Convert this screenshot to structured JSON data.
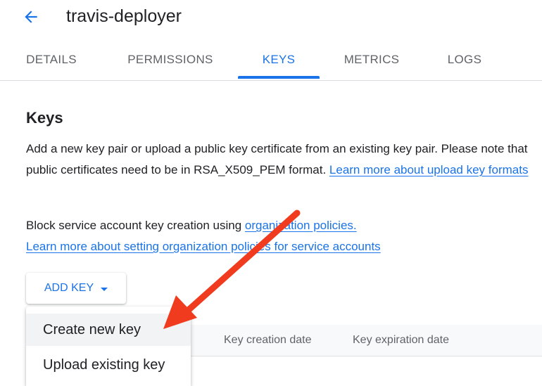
{
  "header": {
    "title": "travis-deployer"
  },
  "tabs": [
    {
      "label": "DETAILS"
    },
    {
      "label": "PERMISSIONS"
    },
    {
      "label": "KEYS"
    },
    {
      "label": "METRICS"
    },
    {
      "label": "LOGS"
    }
  ],
  "active_tab": "KEYS",
  "section": {
    "title": "Keys",
    "description": "Add a new key pair or upload a public key certificate from an existing key pair. Please note that public certificates need to be in RSA_X509_PEM format. ",
    "learn_formats_link": "Learn more about upload key formats",
    "block_text": "Block service account key creation using ",
    "org_policies_link": "organization policies.",
    "learn_org_link": "Learn more about setting organization policies for service accounts"
  },
  "add_key_button": {
    "label": "ADD KEY"
  },
  "menu": {
    "items": [
      {
        "label": "Create new key"
      },
      {
        "label": "Upload existing key"
      }
    ]
  },
  "table": {
    "columns": [
      {
        "label": "Key creation date"
      },
      {
        "label": "Key expiration date"
      }
    ]
  },
  "colors": {
    "accent": "#1a73e8",
    "annotation_arrow": "#f03b1f"
  }
}
